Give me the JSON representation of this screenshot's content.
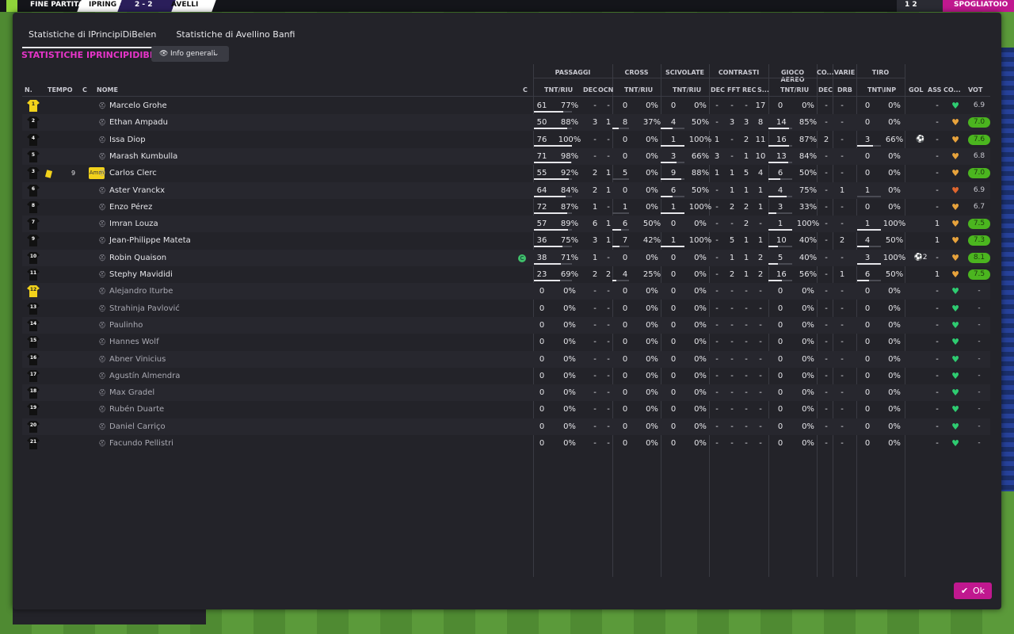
{
  "topbar": {
    "status": "FINE PARTITA",
    "home": "IPRING",
    "score": "2 - 2",
    "away": "AVELLI",
    "right_btn": "SPOGLIATOIO",
    "right_count": "1 2"
  },
  "tabs": [
    {
      "label": "Statistiche di IPrincipiDiBelen",
      "active": true
    },
    {
      "label": "Statistiche di Avellino Banfi",
      "active": false
    }
  ],
  "section_title": "STATISTICHE IPRINCIPIDIBELEN",
  "dropdown": {
    "label": "Info generali"
  },
  "groups": {
    "passaggi": "PASSAGGI",
    "cross": "CROSS",
    "scivolate": "SCIVOLATE",
    "contrasti": "CONTRASTI",
    "gioco_aereo": "GIOCO AEREO",
    "co": "CO...",
    "varie": "VARIE",
    "tiro": "TIRO"
  },
  "headers": {
    "n": "N.",
    "tempo": "TEMPO",
    "c": "C",
    "nome": "NOME",
    "c2": "C",
    "tnt_riu": "TNT/RIU",
    "dec": "DEC",
    "ocn": "OCN",
    "cross_tr": "TNT/RIU",
    "sciv_tr": "TNT/RIU",
    "cdec": "DEC",
    "fft": "FFT",
    "rec": "REC",
    "s": "S...",
    "aer_tr": "TNT/RIU",
    "codec": "DEC",
    "drb": "DRB",
    "tnt_inp": "TNT\\INP",
    "gol": "GOL",
    "ass": "ASS",
    "co2": "CO...",
    "vot": "VOT"
  },
  "players": [
    {
      "n": "1",
      "gk": true,
      "name": "Marcelo Grohe",
      "pt": "61",
      "pp": "77%",
      "pdec": "-",
      "pocn": "-",
      "ct": "0",
      "cp": "0%",
      "st": "0",
      "sp": "0%",
      "cdec": "-",
      "fft": "-",
      "rec": "-",
      "s": "17",
      "at": "0",
      "ap": "0%",
      "codec": "-",
      "drb": "-",
      "tt": "0",
      "tp": "0%",
      "gol": "",
      "ass": "-",
      "cond": "green",
      "vote": "6.9",
      "vg": false
    },
    {
      "n": "2",
      "name": "Ethan Ampadu",
      "pt": "50",
      "pp": "88%",
      "pdec": "3",
      "pocn": "1",
      "ct": "8",
      "cp": "37%",
      "st": "4",
      "sp": "50%",
      "cdec": "-",
      "fft": "3",
      "rec": "3",
      "s": "8",
      "at": "14",
      "ap": "85%",
      "codec": "-",
      "drb": "-",
      "tt": "0",
      "tp": "0%",
      "gol": "",
      "ass": "-",
      "cond": "orange",
      "vote": "7.0",
      "vg": true
    },
    {
      "n": "4",
      "name": "Issa Diop",
      "pt": "76",
      "pp": "100%",
      "pdec": "-",
      "pocn": "-",
      "ct": "0",
      "cp": "0%",
      "st": "1",
      "sp": "100%",
      "cdec": "1",
      "fft": "-",
      "rec": "2",
      "s": "11",
      "at": "16",
      "ap": "87%",
      "codec": "2",
      "drb": "-",
      "tt": "3",
      "tp": "66%",
      "gol": "⚽",
      "ass": "-",
      "cond": "orange",
      "vote": "7.6",
      "vg": true
    },
    {
      "n": "5",
      "name": "Marash Kumbulla",
      "pt": "71",
      "pp": "98%",
      "pdec": "-",
      "pocn": "-",
      "ct": "0",
      "cp": "0%",
      "st": "3",
      "sp": "66%",
      "cdec": "3",
      "fft": "-",
      "rec": "1",
      "s": "10",
      "at": "13",
      "ap": "84%",
      "codec": "-",
      "drb": "-",
      "tt": "0",
      "tp": "0%",
      "gol": "",
      "ass": "-",
      "cond": "orange",
      "vote": "6.8",
      "vg": false
    },
    {
      "n": "3",
      "name": "Carlos Clerc",
      "yellow": true,
      "time": "9",
      "amm": "Amm",
      "pt": "55",
      "pp": "92%",
      "pdec": "2",
      "pocn": "1",
      "ct": "5",
      "cp": "0%",
      "st": "9",
      "sp": "88%",
      "cdec": "1",
      "fft": "1",
      "rec": "5",
      "s": "4",
      "at": "6",
      "ap": "50%",
      "codec": "-",
      "drb": "-",
      "tt": "0",
      "tp": "0%",
      "gol": "",
      "ass": "-",
      "cond": "orange",
      "vote": "7.0",
      "vg": true
    },
    {
      "n": "6",
      "name": "Aster Vranckx",
      "pt": "64",
      "pp": "84%",
      "pdec": "2",
      "pocn": "1",
      "ct": "0",
      "cp": "0%",
      "st": "6",
      "sp": "50%",
      "cdec": "-",
      "fft": "1",
      "rec": "1",
      "s": "1",
      "at": "4",
      "ap": "75%",
      "codec": "-",
      "drb": "1",
      "tt": "1",
      "tp": "0%",
      "gol": "",
      "ass": "-",
      "cond": "red",
      "vote": "6.9",
      "vg": false
    },
    {
      "n": "8",
      "name": "Enzo Pérez",
      "pt": "72",
      "pp": "87%",
      "pdec": "1",
      "pocn": "-",
      "ct": "1",
      "cp": "0%",
      "st": "1",
      "sp": "100%",
      "cdec": "-",
      "fft": "2",
      "rec": "2",
      "s": "1",
      "at": "3",
      "ap": "33%",
      "codec": "-",
      "drb": "-",
      "tt": "0",
      "tp": "0%",
      "gol": "",
      "ass": "-",
      "cond": "orange",
      "vote": "6.7",
      "vg": false
    },
    {
      "n": "7",
      "name": "Imran Louza",
      "pt": "57",
      "pp": "89%",
      "pdec": "6",
      "pocn": "1",
      "ct": "6",
      "cp": "50%",
      "st": "0",
      "sp": "0%",
      "cdec": "-",
      "fft": "-",
      "rec": "2",
      "s": "-",
      "at": "1",
      "ap": "100%",
      "codec": "-",
      "drb": "-",
      "tt": "1",
      "tp": "100%",
      "gol": "",
      "ass": "1",
      "cond": "orange",
      "vote": "7.5",
      "vg": true
    },
    {
      "n": "9",
      "name": "Jean-Philippe Mateta",
      "pt": "36",
      "pp": "75%",
      "pdec": "3",
      "pocn": "1",
      "ct": "7",
      "cp": "42%",
      "st": "1",
      "sp": "100%",
      "cdec": "-",
      "fft": "5",
      "rec": "1",
      "s": "1",
      "at": "10",
      "ap": "40%",
      "codec": "-",
      "drb": "2",
      "tt": "4",
      "tp": "50%",
      "gol": "",
      "ass": "1",
      "cond": "orange",
      "vote": "7.3",
      "vg": true
    },
    {
      "n": "10",
      "name": "Robin Quaison",
      "cap": true,
      "pt": "38",
      "pp": "71%",
      "pdec": "1",
      "pocn": "-",
      "ct": "0",
      "cp": "0%",
      "st": "0",
      "sp": "0%",
      "cdec": "-",
      "fft": "1",
      "rec": "1",
      "s": "2",
      "at": "5",
      "ap": "40%",
      "codec": "-",
      "drb": "-",
      "tt": "3",
      "tp": "100%",
      "gol": "⚽2",
      "ass": "-",
      "cond": "orange",
      "vote": "8.1",
      "vg": true
    },
    {
      "n": "11",
      "name": "Stephy Mavididi",
      "pt": "23",
      "pp": "69%",
      "pdec": "2",
      "pocn": "2",
      "ct": "4",
      "cp": "25%",
      "st": "0",
      "sp": "0%",
      "cdec": "-",
      "fft": "2",
      "rec": "1",
      "s": "2",
      "at": "16",
      "ap": "56%",
      "codec": "-",
      "drb": "1",
      "tt": "6",
      "tp": "50%",
      "gol": "",
      "ass": "1",
      "cond": "orange",
      "vote": "7.5",
      "vg": true
    },
    {
      "n": "12",
      "gk": true,
      "sub": true,
      "name": "Alejandro Iturbe",
      "pt": "0",
      "pp": "0%",
      "pdec": "-",
      "pocn": "-",
      "ct": "0",
      "cp": "0%",
      "st": "0",
      "sp": "0%",
      "cdec": "-",
      "fft": "-",
      "rec": "-",
      "s": "-",
      "at": "0",
      "ap": "0%",
      "codec": "-",
      "drb": "-",
      "tt": "0",
      "tp": "0%",
      "gol": "",
      "ass": "-",
      "cond": "green",
      "vote": "-",
      "vg": false
    },
    {
      "n": "13",
      "sub": true,
      "name": "Strahinja Pavlović",
      "pt": "0",
      "pp": "0%",
      "pdec": "-",
      "pocn": "-",
      "ct": "0",
      "cp": "0%",
      "st": "0",
      "sp": "0%",
      "cdec": "-",
      "fft": "-",
      "rec": "-",
      "s": "-",
      "at": "0",
      "ap": "0%",
      "codec": "-",
      "drb": "-",
      "tt": "0",
      "tp": "0%",
      "gol": "",
      "ass": "-",
      "cond": "green",
      "vote": "-",
      "vg": false
    },
    {
      "n": "14",
      "sub": true,
      "name": "Paulinho",
      "pt": "0",
      "pp": "0%",
      "pdec": "-",
      "pocn": "-",
      "ct": "0",
      "cp": "0%",
      "st": "0",
      "sp": "0%",
      "cdec": "-",
      "fft": "-",
      "rec": "-",
      "s": "-",
      "at": "0",
      "ap": "0%",
      "codec": "-",
      "drb": "-",
      "tt": "0",
      "tp": "0%",
      "gol": "",
      "ass": "-",
      "cond": "green",
      "vote": "-",
      "vg": false
    },
    {
      "n": "15",
      "sub": true,
      "name": "Hannes Wolf",
      "pt": "0",
      "pp": "0%",
      "pdec": "-",
      "pocn": "-",
      "ct": "0",
      "cp": "0%",
      "st": "0",
      "sp": "0%",
      "cdec": "-",
      "fft": "-",
      "rec": "-",
      "s": "-",
      "at": "0",
      "ap": "0%",
      "codec": "-",
      "drb": "-",
      "tt": "0",
      "tp": "0%",
      "gol": "",
      "ass": "-",
      "cond": "green",
      "vote": "-",
      "vg": false
    },
    {
      "n": "16",
      "sub": true,
      "name": "Abner Vinicius",
      "pt": "0",
      "pp": "0%",
      "pdec": "-",
      "pocn": "-",
      "ct": "0",
      "cp": "0%",
      "st": "0",
      "sp": "0%",
      "cdec": "-",
      "fft": "-",
      "rec": "-",
      "s": "-",
      "at": "0",
      "ap": "0%",
      "codec": "-",
      "drb": "-",
      "tt": "0",
      "tp": "0%",
      "gol": "",
      "ass": "-",
      "cond": "green",
      "vote": "-",
      "vg": false
    },
    {
      "n": "17",
      "sub": true,
      "name": "Agustín Almendra",
      "pt": "0",
      "pp": "0%",
      "pdec": "-",
      "pocn": "-",
      "ct": "0",
      "cp": "0%",
      "st": "0",
      "sp": "0%",
      "cdec": "-",
      "fft": "-",
      "rec": "-",
      "s": "-",
      "at": "0",
      "ap": "0%",
      "codec": "-",
      "drb": "-",
      "tt": "0",
      "tp": "0%",
      "gol": "",
      "ass": "-",
      "cond": "green",
      "vote": "-",
      "vg": false
    },
    {
      "n": "18",
      "sub": true,
      "name": "Max Gradel",
      "pt": "0",
      "pp": "0%",
      "pdec": "-",
      "pocn": "-",
      "ct": "0",
      "cp": "0%",
      "st": "0",
      "sp": "0%",
      "cdec": "-",
      "fft": "-",
      "rec": "-",
      "s": "-",
      "at": "0",
      "ap": "0%",
      "codec": "-",
      "drb": "-",
      "tt": "0",
      "tp": "0%",
      "gol": "",
      "ass": "-",
      "cond": "green",
      "vote": "-",
      "vg": false
    },
    {
      "n": "19",
      "sub": true,
      "name": "Rubén Duarte",
      "pt": "0",
      "pp": "0%",
      "pdec": "-",
      "pocn": "-",
      "ct": "0",
      "cp": "0%",
      "st": "0",
      "sp": "0%",
      "cdec": "-",
      "fft": "-",
      "rec": "-",
      "s": "-",
      "at": "0",
      "ap": "0%",
      "codec": "-",
      "drb": "-",
      "tt": "0",
      "tp": "0%",
      "gol": "",
      "ass": "-",
      "cond": "green",
      "vote": "-",
      "vg": false
    },
    {
      "n": "20",
      "sub": true,
      "name": "Daniel Carriço",
      "pt": "0",
      "pp": "0%",
      "pdec": "-",
      "pocn": "-",
      "ct": "0",
      "cp": "0%",
      "st": "0",
      "sp": "0%",
      "cdec": "-",
      "fft": "-",
      "rec": "-",
      "s": "-",
      "at": "0",
      "ap": "0%",
      "codec": "-",
      "drb": "-",
      "tt": "0",
      "tp": "0%",
      "gol": "",
      "ass": "-",
      "cond": "green",
      "vote": "-",
      "vg": false
    },
    {
      "n": "21",
      "sub": true,
      "name": "Facundo Pellistri",
      "pt": "0",
      "pp": "0%",
      "pdec": "-",
      "pocn": "-",
      "ct": "0",
      "cp": "0%",
      "st": "0",
      "sp": "0%",
      "cdec": "-",
      "fft": "-",
      "rec": "-",
      "s": "-",
      "at": "0",
      "ap": "0%",
      "codec": "-",
      "drb": "-",
      "tt": "0",
      "tp": "0%",
      "gol": "",
      "ass": "-",
      "cond": "green",
      "vote": "-",
      "vg": false
    }
  ],
  "ok_button": {
    "label": "Ok"
  },
  "colors": {
    "accent": "#e535c8",
    "button": "#c0188f",
    "vote_good": "#4bb51f",
    "cond_green": "#2ecc71",
    "cond_orange": "#e8a33c",
    "cond_red": "#e0662e",
    "kit_gk": "#f2d21b",
    "kit": "#111111"
  }
}
